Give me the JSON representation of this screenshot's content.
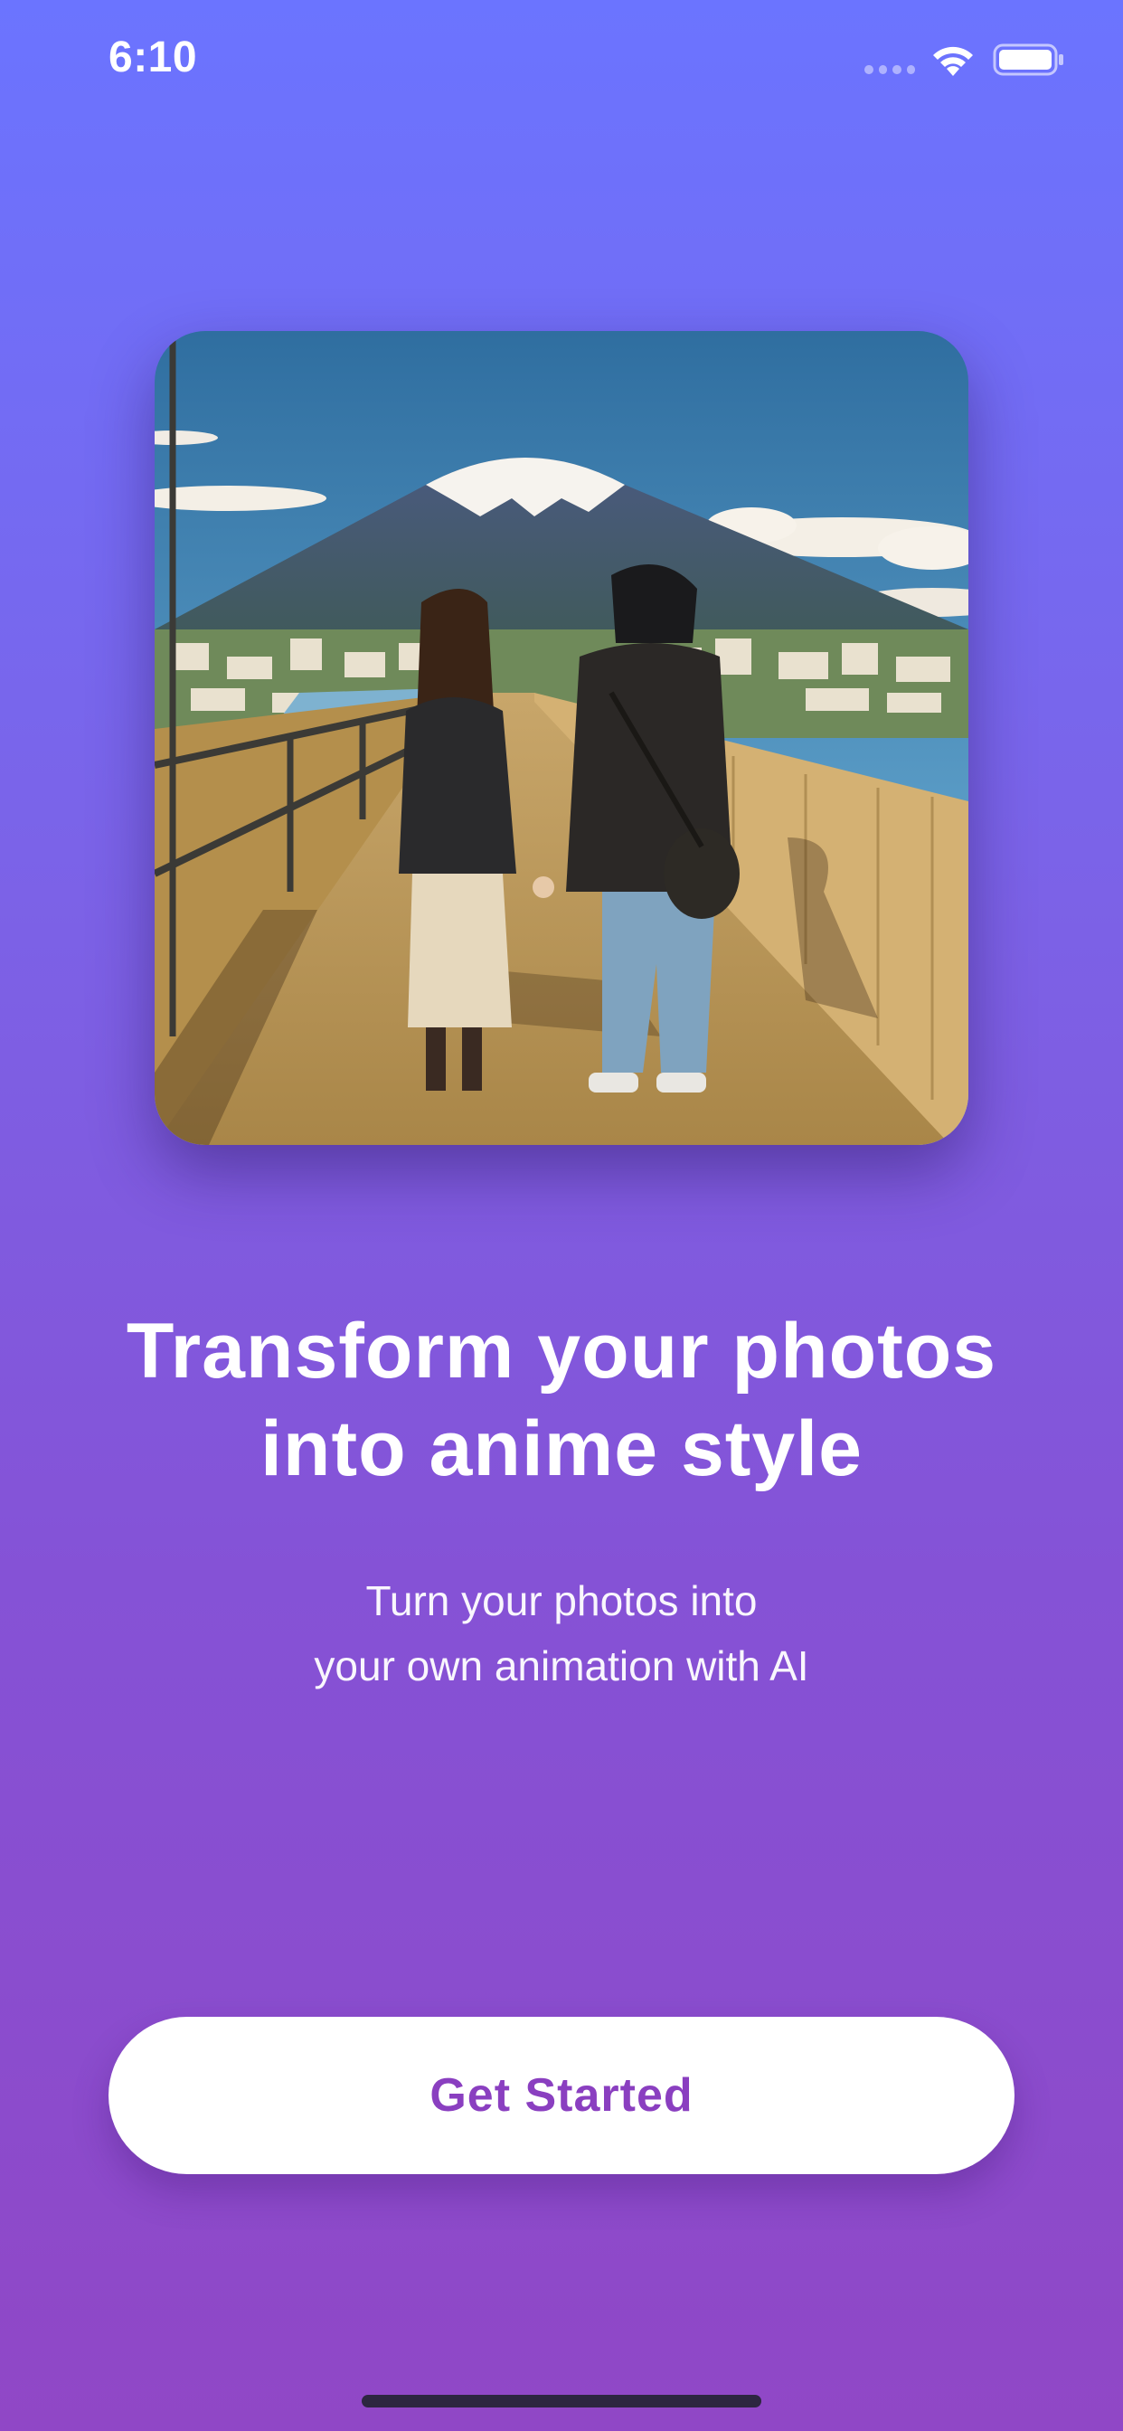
{
  "status_bar": {
    "time": "6:10"
  },
  "hero": {
    "image_description_icon": "anime-couple-mount-fuji-illustration"
  },
  "onboarding": {
    "headline_line1": "Transform your photos",
    "headline_line2": "into anime style",
    "subheadline_line1": "Turn your photos into",
    "subheadline_line2": "your own animation with AI"
  },
  "cta": {
    "label": "Get Started"
  },
  "colors": {
    "gradient_top": "#6b74ff",
    "gradient_bottom": "#9047c6",
    "cta_text": "#8a3fc0",
    "cta_bg": "#ffffff"
  }
}
